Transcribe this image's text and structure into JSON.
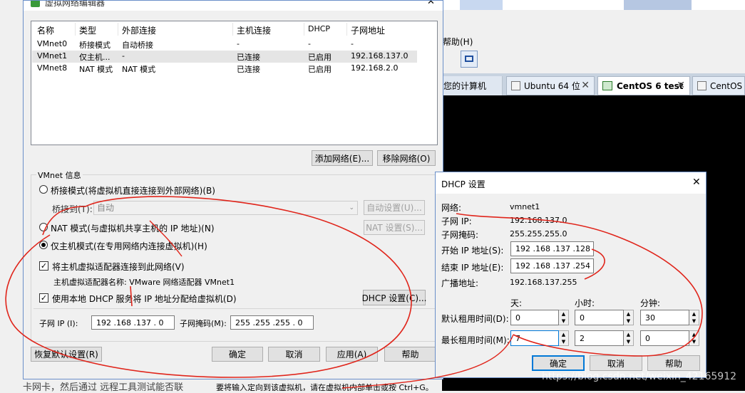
{
  "bg": {
    "menu_help": "帮助(H)",
    "tabs": [
      "您的计算机",
      "Ubuntu 64 位",
      "CentOS 6 test",
      "CentOS"
    ],
    "bottom_left": "卡网卡，然后通过 远程工具测试能否联",
    "bottom_right": "要将输入定向到该虚拟机，请在虚拟机内部单击或按 Ctrl+G。"
  },
  "vne": {
    "title": "虚拟网络编辑器",
    "headers": [
      "名称",
      "类型",
      "外部连接",
      "主机连接",
      "DHCP",
      "子网地址"
    ],
    "rows": [
      [
        "VMnet0",
        "桥接模式",
        "自动桥接",
        "-",
        "-",
        "-"
      ],
      [
        "VMnet1",
        "仅主机...",
        "-",
        "已连接",
        "已启用",
        "192.168.137.0"
      ],
      [
        "VMnet8",
        "NAT 模式",
        "NAT 模式",
        "已连接",
        "已启用",
        "192.168.2.0"
      ]
    ],
    "add_network": "添加网络(E)...",
    "remove_network": "移除网络(O)",
    "info_title": "VMnet 信息",
    "bridged_mode": "桥接模式(将虚拟机直接连接到外部网络)(B)",
    "bridged_to": "桥接到(T):",
    "bridged_value": "自动",
    "auto_settings": "自动设置(U)...",
    "nat_mode": "NAT 模式(与虚拟机共享主机的 IP 地址)(N)",
    "nat_settings": "NAT 设置(S)...",
    "host_only": "仅主机模式(在专用网络内连接虚拟机)(H)",
    "connect_adapter": "将主机虚拟适配器连接到此网络(V)",
    "adapter_name": "主机虚拟适配器名称: VMware 网络适配器 VMnet1",
    "use_dhcp": "使用本地 DHCP 服务将 IP 地址分配给虚拟机(D)",
    "dhcp_settings": "DHCP 设置(C)...",
    "subnet_ip_label": "子网 IP (I):",
    "subnet_ip": "192 .168 .137 . 0",
    "subnet_mask_label": "子网掩码(M):",
    "subnet_mask": "255 .255 .255 . 0",
    "restore": "恢复默认设置(R)",
    "ok": "确定",
    "cancel": "取消",
    "apply": "应用(A)",
    "help": "帮助"
  },
  "dhcp": {
    "title": "DHCP 设置",
    "close": "✕",
    "network_label": "网络:",
    "network": "vmnet1",
    "subnet_ip_label": "子网 IP:",
    "subnet_ip": "192.168.137.0",
    "subnet_mask_label": "子网掩码:",
    "subnet_mask": "255.255.255.0",
    "start_ip_label": "开始 IP 地址(S):",
    "start_ip": "192 .168 .137 .128",
    "end_ip_label": "结束 IP 地址(E):",
    "end_ip": "192 .168 .137 .254",
    "broadcast_label": "广播地址:",
    "broadcast": "192.168.137.255",
    "days": "天:",
    "hours": "小时:",
    "minutes": "分钟:",
    "default_lease_label": "默认租用时间(D):",
    "default_lease": [
      "0",
      "0",
      "30"
    ],
    "max_lease_label": "最长租用时间(M):",
    "max_lease": [
      "7",
      "2",
      "0"
    ],
    "ok": "确定",
    "cancel": "取消",
    "help": "帮助"
  },
  "watermark": "https://blog.csdn.net/weixin_42165912"
}
